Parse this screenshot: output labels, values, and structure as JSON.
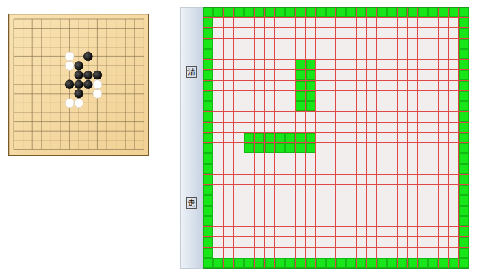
{
  "board": {
    "size": 15,
    "stones": [
      {
        "col": 6,
        "row": 4,
        "color": "#ffffff"
      },
      {
        "col": 8,
        "row": 4,
        "color": "#000000"
      },
      {
        "col": 6,
        "row": 5,
        "color": "#ffffff"
      },
      {
        "col": 7,
        "row": 5,
        "color": "#000000"
      },
      {
        "col": 7,
        "row": 6,
        "color": "#000000"
      },
      {
        "col": 8,
        "row": 6,
        "color": "#000000"
      },
      {
        "col": 9,
        "row": 6,
        "color": "#000000"
      },
      {
        "col": 6,
        "row": 7,
        "color": "#000000"
      },
      {
        "col": 7,
        "row": 7,
        "color": "#000000"
      },
      {
        "col": 8,
        "row": 7,
        "color": "#000000"
      },
      {
        "col": 9,
        "row": 7,
        "color": "#ffffff"
      },
      {
        "col": 7,
        "row": 8,
        "color": "#000000"
      },
      {
        "col": 9,
        "row": 8,
        "color": "#ffffff"
      },
      {
        "col": 6,
        "row": 9,
        "color": "#ffffff"
      },
      {
        "col": 7,
        "row": 9,
        "color": "#ffffff"
      }
    ]
  },
  "buttons": [
    {
      "label": "清"
    },
    {
      "label": "走"
    }
  ],
  "grid": {
    "cols": 26,
    "rows": 25,
    "blocks": [
      {
        "col": 9,
        "row": 5,
        "cols": 2,
        "rows": 5
      },
      {
        "col": 4,
        "row": 12,
        "cols": 7,
        "rows": 2
      }
    ]
  }
}
